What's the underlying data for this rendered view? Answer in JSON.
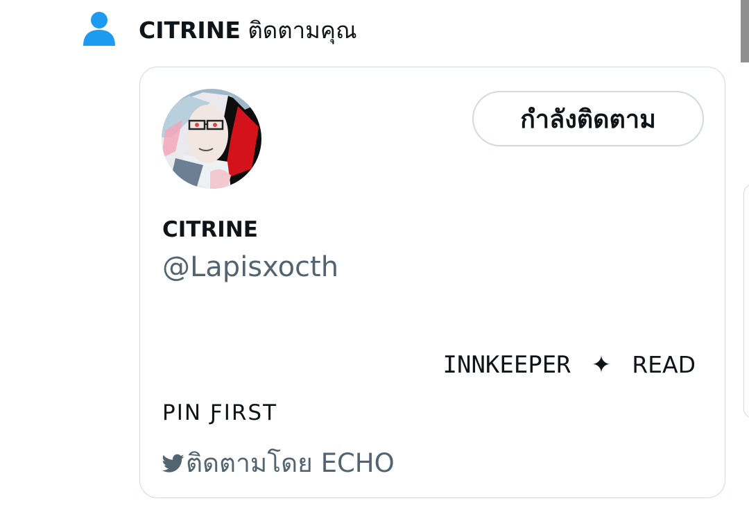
{
  "notification": {
    "icon": "person-icon",
    "name": "CITRINE",
    "text": "ติดตามคุณ"
  },
  "card": {
    "avatar_alt": "avatar",
    "follow_button": "กำลังติดตาม",
    "display_name": "CITRINE",
    "handle": "@Lapisxocth",
    "bio": {
      "word1": "INNKEEPER",
      "star": "✦",
      "word2": "READ",
      "line2": "PIN ƑIRST"
    },
    "followed_by": "ติดตามโดย ECHO"
  },
  "colors": {
    "accent": "#1d9bf0",
    "text_primary": "#0f1419",
    "text_secondary": "#536471",
    "border": "#cfd9de"
  }
}
